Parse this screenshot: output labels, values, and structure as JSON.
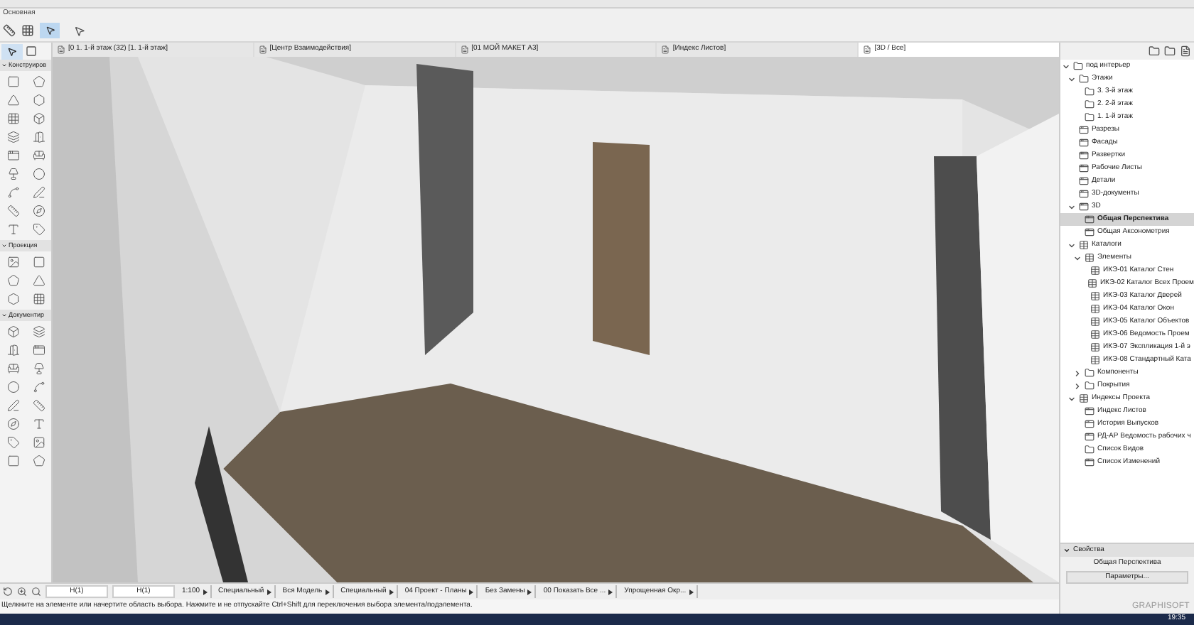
{
  "ribbon": {
    "label": "Основная"
  },
  "view_tabs": [
    {
      "label": "[0 1. 1-й этаж (32) [1. 1-й этаж]",
      "selected": false
    },
    {
      "label": "[Центр Взаимодействия]",
      "selected": false
    },
    {
      "label": "[01 МОЙ МАКЕТ А3]",
      "selected": false
    },
    {
      "label": "[Индекс Листов]",
      "selected": false
    },
    {
      "label": "[3D / Все]",
      "selected": true
    }
  ],
  "toolbox": {
    "sections": [
      {
        "title": "Конструиров"
      },
      {
        "title": "Проекция"
      },
      {
        "title": "Документир"
      }
    ]
  },
  "navigator": {
    "tree": [
      {
        "label": "под интерьер",
        "kind": "folder",
        "selected": false,
        "expanded": true,
        "children": [
          {
            "label": "Этажи",
            "kind": "folder",
            "selected": false,
            "expanded": true,
            "children": [
              {
                "label": "3. 3-й этаж",
                "kind": "folder",
                "selected": false
              },
              {
                "label": "2. 2-й этаж",
                "kind": "folder",
                "selected": false
              },
              {
                "label": "1. 1-й этаж",
                "kind": "folder",
                "selected": false
              }
            ]
          },
          {
            "label": "Разрезы",
            "kind": "view",
            "selected": false
          },
          {
            "label": "Фасады",
            "kind": "view",
            "selected": false
          },
          {
            "label": "Развертки",
            "kind": "view",
            "selected": false
          },
          {
            "label": "Рабочие Листы",
            "kind": "view",
            "selected": false
          },
          {
            "label": "Детали",
            "kind": "view",
            "selected": false
          },
          {
            "label": "3D-документы",
            "kind": "view",
            "selected": false
          },
          {
            "label": "3D",
            "kind": "view",
            "selected": false,
            "expanded": true,
            "children": [
              {
                "label": "Общая Перспектива",
                "kind": "view",
                "selected": true
              },
              {
                "label": "Общая Аксонометрия",
                "kind": "view",
                "selected": false
              }
            ]
          },
          {
            "label": "Каталоги",
            "kind": "schedule",
            "selected": false,
            "expanded": true,
            "children": [
              {
                "label": "Элементы",
                "kind": "schedule",
                "selected": false,
                "expanded": true,
                "children": [
                  {
                    "label": "ИКЭ-01 Каталог Стен",
                    "kind": "schedule",
                    "selected": false
                  },
                  {
                    "label": "ИКЭ-02 Каталог Всех Проем",
                    "kind": "schedule",
                    "selected": false
                  },
                  {
                    "label": "ИКЭ-03 Каталог Дверей",
                    "kind": "schedule",
                    "selected": false
                  },
                  {
                    "label": "ИКЭ-04 Каталог Окон",
                    "kind": "schedule",
                    "selected": false
                  },
                  {
                    "label": "ИКЭ-05 Каталог Объектов",
                    "kind": "schedule",
                    "selected": false
                  },
                  {
                    "label": "ИКЭ-06 Ведомость Проем",
                    "kind": "schedule",
                    "selected": false
                  },
                  {
                    "label": "ИКЭ-07 Экспликация 1-й э",
                    "kind": "schedule",
                    "selected": false
                  },
                  {
                    "label": "ИКЭ-08 Стандартный Ката",
                    "kind": "schedule",
                    "selected": false
                  }
                ]
              },
              {
                "label": "Компоненты",
                "kind": "folder",
                "selected": false,
                "expanded": false
              },
              {
                "label": "Покрытия",
                "kind": "folder",
                "selected": false,
                "expanded": false
              }
            ]
          },
          {
            "label": "Индексы Проекта",
            "kind": "schedule",
            "selected": false,
            "expanded": true,
            "children": [
              {
                "label": "Индекс Листов",
                "kind": "view",
                "selected": false
              },
              {
                "label": "История Выпусков",
                "kind": "view",
                "selected": false
              },
              {
                "label": "РД-АР Ведомость рабочих ч",
                "kind": "view",
                "selected": false
              },
              {
                "label": "Список Видов",
                "kind": "folder",
                "selected": false
              },
              {
                "label": "Список Изменений",
                "kind": "view",
                "selected": false
              }
            ]
          }
        ]
      }
    ]
  },
  "properties": {
    "title": "Свойства",
    "value": "Общая Перспектива",
    "button": "Параметры..."
  },
  "logo": "GRAPHISOFT",
  "view_bar": [
    {
      "kind": "field",
      "text": "Н(1)"
    },
    {
      "kind": "field",
      "text": "Н(1)"
    },
    {
      "kind": "menu",
      "text": "1:100"
    },
    {
      "kind": "menu",
      "text": "Специальный"
    },
    {
      "kind": "menu",
      "text": "Вся Модель"
    },
    {
      "kind": "menu",
      "text": "Специальный"
    },
    {
      "kind": "menu",
      "text": "04 Проект - Планы"
    },
    {
      "kind": "menu",
      "text": "Без Замены"
    },
    {
      "kind": "menu",
      "text": "00 Показать Все ..."
    },
    {
      "kind": "menu",
      "text": "Упрощенная Окр..."
    }
  ],
  "status_text": "Щелкните на элементе или начертите область выбора. Нажмите и не отпускайте Ctrl+Shift для переключения выбора элемента/подэлемента.",
  "taskbar": {
    "time": "19:35"
  }
}
